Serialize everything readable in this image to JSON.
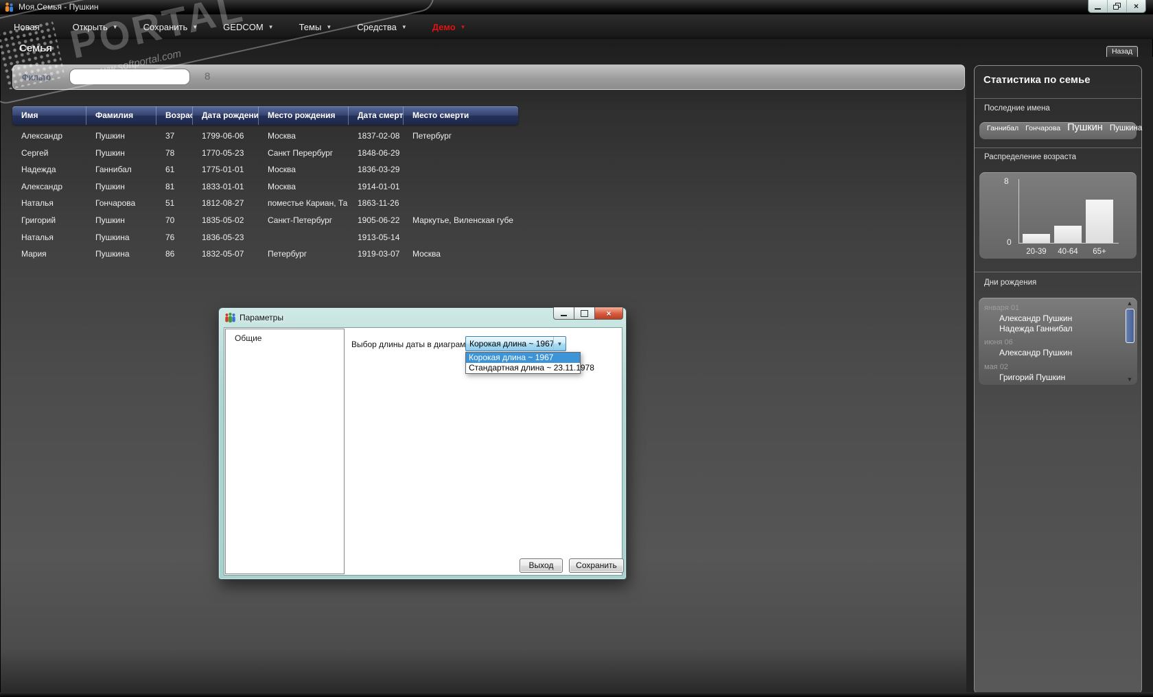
{
  "window": {
    "title": "Моя.Семья - Пушкин"
  },
  "icons": {
    "caret_down": "▼",
    "scroll_up": "▲",
    "scroll_down": "▼",
    "close": "×"
  },
  "colors": {
    "menu_accent": "#e01212",
    "selection_blue": "#3d95d8",
    "scroll_thumb": "#5574a6",
    "table_header_navy": "#2c3a63"
  },
  "menu": {
    "items": [
      {
        "label": "Новая",
        "arrow": false
      },
      {
        "label": "Открыть",
        "arrow": true
      },
      {
        "label": "Сохранить",
        "arrow": true
      },
      {
        "label": "GEDCOM",
        "arrow": true
      },
      {
        "label": "Темы",
        "arrow": true
      },
      {
        "label": "Средства",
        "arrow": true
      },
      {
        "label": "Демо",
        "arrow": true,
        "accent": true
      }
    ]
  },
  "page": {
    "title": "Семья",
    "back_label": "Назад",
    "filter_label": "Фильтр",
    "filter_value": "",
    "record_count": "8"
  },
  "table": {
    "columns": [
      "Имя",
      "Фамилия",
      "Возраст",
      "Дата рождения",
      "Место рождения",
      "Дата смерти",
      "Место смерти"
    ],
    "rows": [
      [
        "Александр",
        "Пушкин",
        "37",
        "1799-06-06",
        "Москва",
        "1837-02-08",
        "Петербург"
      ],
      [
        "Сергей",
        "Пушкин",
        "78",
        "1770-05-23",
        "Санкт Перербург",
        "1848-06-29",
        ""
      ],
      [
        "Надежда",
        "Ганнибал",
        "61",
        "1775-01-01",
        "Москва",
        "1836-03-29",
        ""
      ],
      [
        "Александр",
        "Пушкин",
        "81",
        "1833-01-01",
        "Москва",
        "1914-01-01",
        ""
      ],
      [
        "Наталья",
        "Гончарова",
        "51",
        "1812-08-27",
        "поместье Кариан, Та",
        "1863-11-26",
        ""
      ],
      [
        "Григорий",
        "Пушкин",
        "70",
        "1835-05-02",
        "Санкт-Петербург",
        "1905-06-22",
        "Маркутье, Виленская губе"
      ],
      [
        "Наталья",
        "Пушкина",
        "76",
        "1836-05-23",
        "",
        "1913-05-14",
        ""
      ],
      [
        "Мария",
        "Пушкина",
        "86",
        "1832-05-07",
        "Петербург",
        "1919-03-07",
        "Москва"
      ]
    ]
  },
  "sidebar": {
    "title": "Статистика по семье",
    "last_names": {
      "label": "Последние имена",
      "tags": [
        {
          "text": "Ганнибал",
          "size": "s"
        },
        {
          "text": "Гончарова",
          "size": "s"
        },
        {
          "text": "Пушкин",
          "size": "l"
        },
        {
          "text": "Пушкина",
          "size": "m"
        }
      ]
    },
    "age_dist": {
      "label": "Распределение возраста"
    },
    "birthdays": {
      "label": "Дни рождения",
      "groups": [
        {
          "date": "января 01",
          "names": [
            "Александр Пушкин",
            "Надежда Ганнибал"
          ]
        },
        {
          "date": "июня 06",
          "names": [
            "Александр Пушкин"
          ]
        },
        {
          "date": "мая 02",
          "names": [
            "Григорий Пушкин"
          ]
        }
      ]
    }
  },
  "chart_data": {
    "type": "bar",
    "title": "Распределение возраста",
    "categories": [
      "20-39",
      "40-64",
      "65+"
    ],
    "values": [
      1,
      2,
      5
    ],
    "xlabel": "",
    "ylabel": "",
    "ylim": [
      0,
      8
    ],
    "yticks": [
      "0",
      "8"
    ],
    "grid": false,
    "bar_color": "#ececec"
  },
  "dialog": {
    "title": "Параметры",
    "nav_items": [
      "Общие"
    ],
    "field_label": "Выбор длины даты в диаграмме",
    "combobox": {
      "value": "Корокая длина ~ 1967",
      "options": [
        "Корокая длина ~ 1967",
        "Стандартная длина ~ 23.11.1978"
      ],
      "selected_index": 0
    },
    "buttons": {
      "exit": "Выход",
      "save": "Сохранить"
    }
  },
  "watermark": {
    "text": "PORTAL",
    "tm": "™",
    "url": "www.softportal.com"
  }
}
